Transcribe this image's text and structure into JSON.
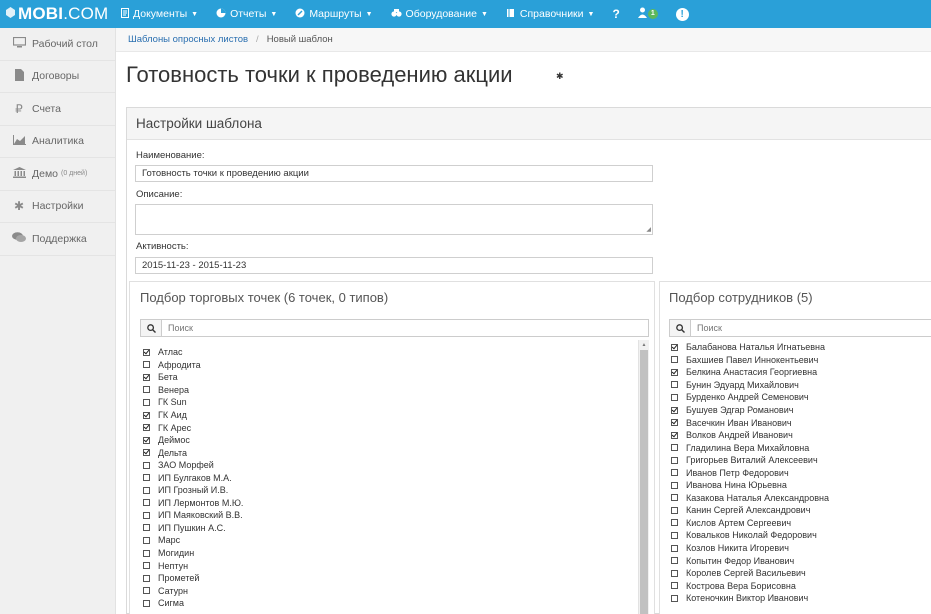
{
  "app": {
    "brand_bold": "MOBI",
    "brand_light": ".COM"
  },
  "topnav": {
    "items": [
      {
        "label": "Документы",
        "icon": "document-icon"
      },
      {
        "label": "Отчеты",
        "icon": "pie-chart-icon"
      },
      {
        "label": "Маршруты",
        "icon": "route-icon"
      },
      {
        "label": "Оборудование",
        "icon": "equipment-icon"
      },
      {
        "label": "Справочники",
        "icon": "book-icon"
      }
    ],
    "help_label": "?",
    "notifications_badge": "1",
    "alert_label": "!"
  },
  "sidebar": {
    "items": [
      {
        "label": "Рабочий стол",
        "icon": "desktop-icon",
        "suffix": ""
      },
      {
        "label": "Договоры",
        "icon": "file-icon",
        "suffix": ""
      },
      {
        "label": "Счета",
        "icon": "ruble-icon",
        "suffix": ""
      },
      {
        "label": "Аналитика",
        "icon": "area-chart-icon",
        "suffix": ""
      },
      {
        "label": "Демо",
        "icon": "bank-icon",
        "suffix": "(0 дней)"
      },
      {
        "label": "Настройки",
        "icon": "gear-icon",
        "suffix": ""
      },
      {
        "label": "Поддержка",
        "icon": "chat-icon",
        "suffix": ""
      }
    ]
  },
  "breadcrumb": {
    "link": "Шаблоны опросных листов",
    "separator": "/",
    "current": "Новый шаблон"
  },
  "page": {
    "title": "Готовность точки к проведению акции"
  },
  "settings": {
    "header": "Настройки шаблона",
    "name_label": "Наименование:",
    "name_value": "Готовность точки к проведению акции",
    "description_label": "Описание:",
    "description_value": "",
    "activity_label": "Активность:",
    "activity_value": "2015-11-23 - 2015-11-23"
  },
  "outlets": {
    "title": "Подбор торговых точек  (6 точек, 0 типов)",
    "search_placeholder": "Поиск",
    "items": [
      {
        "label": "Атлас",
        "checked": true
      },
      {
        "label": "Афродита",
        "checked": false
      },
      {
        "label": "Бета",
        "checked": true
      },
      {
        "label": "Венера",
        "checked": false
      },
      {
        "label": "ГК Sun",
        "checked": false
      },
      {
        "label": "ГК Аид",
        "checked": true
      },
      {
        "label": "ГК Арес",
        "checked": true
      },
      {
        "label": "Деймос",
        "checked": true
      },
      {
        "label": "Дельта",
        "checked": true
      },
      {
        "label": "ЗАО Морфей",
        "checked": false
      },
      {
        "label": "ИП Булгаков М.А.",
        "checked": false
      },
      {
        "label": "ИП Грозный И.В.",
        "checked": false
      },
      {
        "label": "ИП Лермонтов М.Ю.",
        "checked": false
      },
      {
        "label": "ИП Маяковский В.В.",
        "checked": false
      },
      {
        "label": "ИП Пушкин А.С.",
        "checked": false
      },
      {
        "label": "Марс",
        "checked": false
      },
      {
        "label": "Могидин",
        "checked": false
      },
      {
        "label": "Нептун",
        "checked": false
      },
      {
        "label": "Прометей",
        "checked": false
      },
      {
        "label": "Сатурн",
        "checked": false
      },
      {
        "label": "Сигма",
        "checked": false
      }
    ]
  },
  "employees": {
    "title": "Подбор сотрудников  (5)",
    "search_placeholder": "Поиск",
    "items": [
      {
        "label": "Балабанова Наталья Игнатьевна",
        "checked": true
      },
      {
        "label": "Бахшиев Павел Иннокентьевич",
        "checked": false
      },
      {
        "label": "Белкина Анастасия Георгиевна",
        "checked": true
      },
      {
        "label": "Бунин Эдуард Михайлович",
        "checked": false
      },
      {
        "label": "Бурденко Андрей Семенович",
        "checked": false
      },
      {
        "label": "Бушуев Эдгар Романович",
        "checked": true
      },
      {
        "label": "Васечкин Иван Иванович",
        "checked": true
      },
      {
        "label": "Волков Андрей Иванович",
        "checked": true
      },
      {
        "label": "Гладилина Вера Михайловна",
        "checked": false
      },
      {
        "label": "Григорьев Виталий Алексеевич",
        "checked": false
      },
      {
        "label": "Иванов Петр Федорович",
        "checked": false
      },
      {
        "label": "Иванова Нина Юрьевна",
        "checked": false
      },
      {
        "label": "Казакова Наталья Александровна",
        "checked": false
      },
      {
        "label": "Канин Сергей Александрович",
        "checked": false
      },
      {
        "label": "Кислов Артем Сергеевич",
        "checked": false
      },
      {
        "label": "Ковальков Николай Федорович",
        "checked": false
      },
      {
        "label": "Козлов Никита Игоревич",
        "checked": false
      },
      {
        "label": "Копытин Федор Иванович",
        "checked": false
      },
      {
        "label": "Королев Сергей Васильевич",
        "checked": false
      },
      {
        "label": "Кострова Вера Борисовна",
        "checked": false
      },
      {
        "label": "Котеночкин Виктор Иванович",
        "checked": false
      }
    ]
  }
}
